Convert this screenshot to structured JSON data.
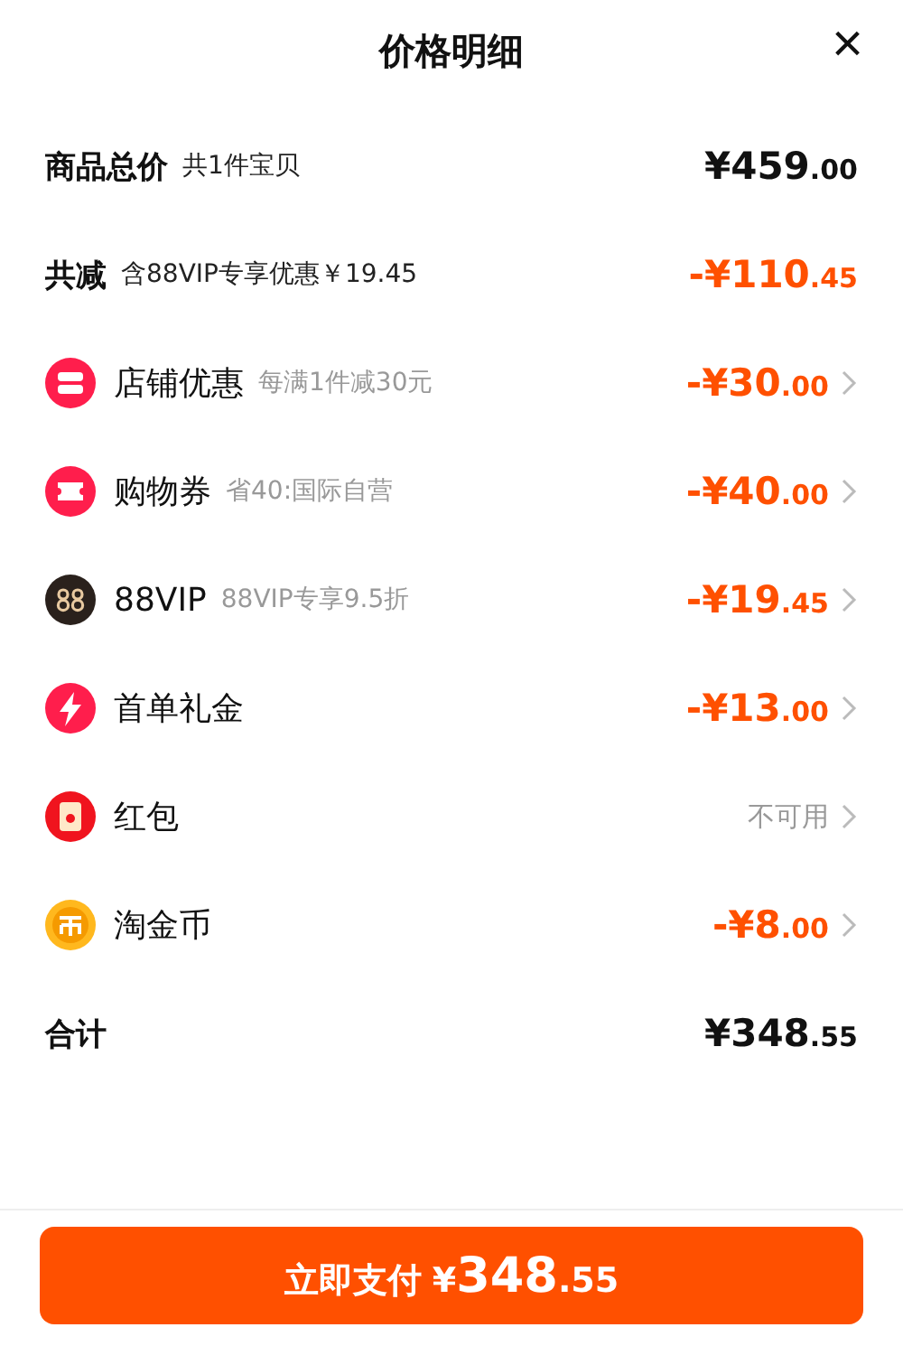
{
  "title": "价格明细",
  "close": "×",
  "rows": [
    {
      "kind": "summary",
      "label": "商品总价",
      "note": "共1件宝贝",
      "amount_main": "¥459",
      "amount_cents": ".00",
      "highlight": false
    },
    {
      "kind": "summary",
      "label": "共减",
      "note": "含88VIP专享优惠￥19.45",
      "amount_main": "-¥110",
      "amount_cents": ".45",
      "highlight": true
    },
    {
      "kind": "discount",
      "label": "店铺优惠",
      "note": "每满1件减30元",
      "amount_main": "-¥30",
      "amount_cents": ".00",
      "highlight": true
    },
    {
      "kind": "discount",
      "label": "购物券",
      "note": "省40:国际自营",
      "amount_main": "-¥40",
      "amount_cents": ".00",
      "highlight": true
    },
    {
      "kind": "discount",
      "label": "88VIP",
      "note": "88VIP专享9.5折",
      "amount_main": "-¥19",
      "amount_cents": ".45",
      "highlight": true
    },
    {
      "kind": "discount",
      "label": "首单礼金",
      "amount_main": "-¥13",
      "amount_cents": ".00",
      "highlight": true
    },
    {
      "kind": "discount",
      "label": "红包",
      "status": "不可用"
    },
    {
      "kind": "discount",
      "label": "淘金币",
      "amount_main": "-¥8",
      "amount_cents": ".00",
      "highlight": true
    },
    {
      "kind": "summary",
      "label": "合计",
      "amount_main": "¥348",
      "amount_cents": ".55",
      "highlight": false
    }
  ],
  "pay_button": {
    "label": "立即支付",
    "amount_main": "¥348",
    "amount_cents": ".55"
  }
}
